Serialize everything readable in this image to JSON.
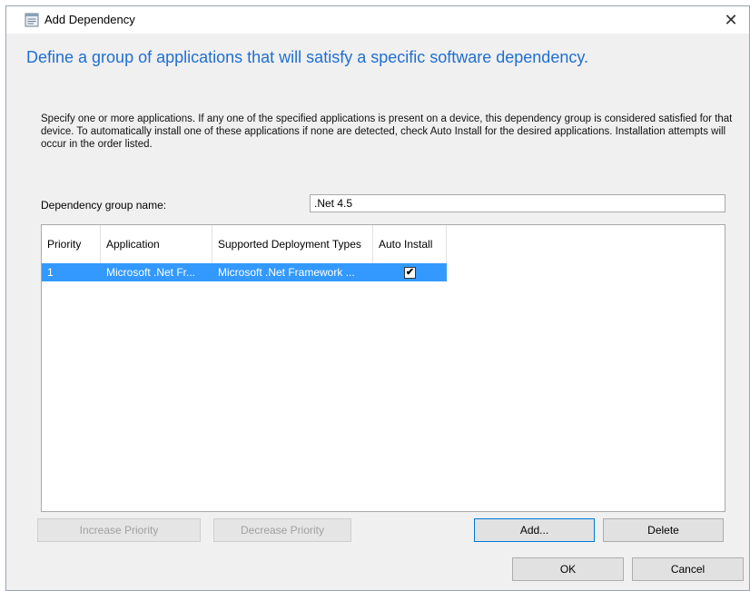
{
  "window": {
    "title": "Add Dependency",
    "close_glyph": "✕"
  },
  "heading": "Define a group of applications that will satisfy a specific software dependency.",
  "description": "Specify one or more applications. If any one of the specified applications is present on a device, this dependency group is considered satisfied for that device. To automatically install one of these applications if none are detected, check Auto Install for the desired applications. Installation attempts will occur in the order listed.",
  "group_name": {
    "label": "Dependency group name:",
    "value": ".Net 4.5"
  },
  "table": {
    "columns": [
      "Priority",
      "Application",
      "Supported Deployment Types",
      "Auto Install"
    ],
    "rows": [
      {
        "priority": "1",
        "application": "Microsoft .Net Fr...",
        "deployment_types": "Microsoft .Net Framework ...",
        "auto_install": "✔",
        "selected": true
      }
    ]
  },
  "buttons": {
    "increase_priority": "Increase Priority",
    "decrease_priority": "Decrease Priority",
    "add": "Add...",
    "delete": "Delete",
    "ok": "OK",
    "cancel": "Cancel"
  },
  "icons": {
    "title_icon": "dialog-window-icon",
    "close": "close-icon",
    "checkbox": "checkmark-icon"
  },
  "colors": {
    "heading": "#1f6fd1",
    "selection": "#3399ff",
    "dialog_bg": "#f0f0f0"
  }
}
